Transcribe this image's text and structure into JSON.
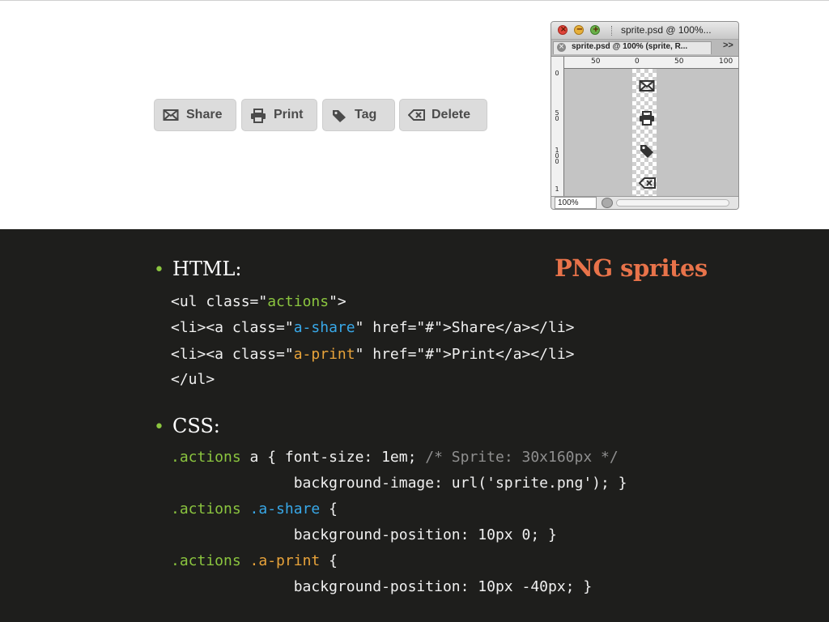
{
  "demo": {
    "buttons": [
      {
        "label": "Share",
        "icon": "envelope-icon"
      },
      {
        "label": "Print",
        "icon": "printer-icon"
      },
      {
        "label": "Tag",
        "icon": "tag-icon"
      },
      {
        "label": "Delete",
        "icon": "delete-icon"
      }
    ]
  },
  "photoshop": {
    "window_title": "sprite.psd @ 100%...",
    "tab_label": "sprite.psd @ 100% (sprite, R...",
    "tab_close": "×",
    "overflow": ">>",
    "ruler_h": [
      "50",
      "0",
      "50",
      "100"
    ],
    "ruler_v": [
      "0",
      "50",
      "100",
      "1"
    ],
    "zoom": "100%",
    "sprite_icons": [
      "envelope-icon",
      "printer-icon",
      "tag-icon",
      "delete-icon"
    ]
  },
  "slide": {
    "title": "PNG sprites",
    "html_heading": "HTML:",
    "css_heading": "CSS:",
    "bullet": "•",
    "html_code": {
      "l1": [
        "<ul class=\"",
        "actions",
        "\">"
      ],
      "l2": [
        "<li><a class=\"",
        "a-share",
        "\" href=\"#\">Share</a></li>"
      ],
      "l3": [
        "<li><a class=\"",
        "a-print",
        "\" href=\"#\">Print</a></li>"
      ],
      "l4": "</ul>"
    },
    "css_code": {
      "l1": [
        ".actions",
        " a { font-size: 1em; ",
        "/* Sprite: 30x160px */"
      ],
      "l2": "              background-image: url('sprite.png'); }",
      "l3": [
        ".actions",
        " ",
        ".a-share",
        " {"
      ],
      "l4": "              background-position: 10px 0; }",
      "l5": [
        ".actions",
        " ",
        ".a-print",
        " {"
      ],
      "l6": "              background-position: 10px -40px; }"
    }
  },
  "colors": {
    "slide_bg": "#1e1e1c",
    "accent_green": "#8bc53f",
    "accent_blue": "#38a8e8",
    "accent_orange": "#e8a33a",
    "title_color": "#e8734a"
  }
}
